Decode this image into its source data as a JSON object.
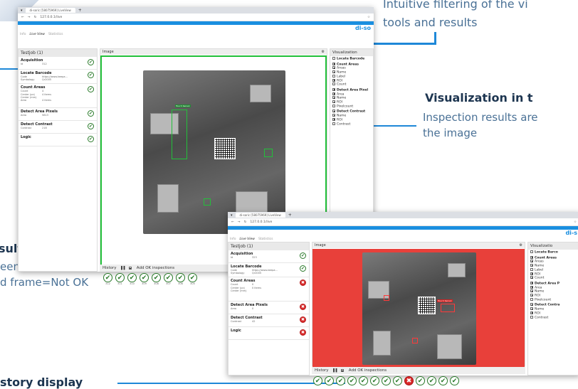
{
  "callouts": {
    "filter_line1": "Intuitive filtering of the vi",
    "filter_line2": "tools and results",
    "vis_title": "Visualization in t",
    "vis_line1": "Inspection results are",
    "vis_line2": "the image",
    "result_title": "sult display",
    "result_line1": "een frame=OK",
    "result_line2": "d frame=Not OK",
    "history_title": "story display"
  },
  "win1": {
    "tab": "di-soric [58075969] LiveView",
    "url": "127.0.0.1/live",
    "brand": "di-so",
    "menu": [
      "Info",
      "Live View",
      "Statistics"
    ],
    "left_title": "Testjob (1)",
    "steps": [
      {
        "name": "Acquisition",
        "rows": [
          [
            "Id",
            "312"
          ]
        ],
        "status": "ok"
      },
      {
        "name": "Locate Barcode",
        "rows": [
          [
            "Code",
            "https://www.keepa..."
          ],
          [
            "Symbology",
            "Qr2005"
          ]
        ],
        "status": "ok"
      },
      {
        "name": "Count Areas",
        "rows": [
          [
            "Count",
            "4"
          ],
          [
            "Center (px)",
            "4 items"
          ],
          [
            "Center (mm)",
            ""
          ],
          [
            "Area",
            "4 items"
          ]
        ],
        "status": "ok"
      },
      {
        "name": "Detect Area Pixels",
        "rows": [
          [
            "Area",
            "5813"
          ]
        ],
        "status": "ok"
      },
      {
        "name": "Detect Contrast",
        "rows": [
          [
            "Contrast",
            "218"
          ]
        ],
        "status": "ok"
      },
      {
        "name": "Logic",
        "rows": [],
        "status": "ok"
      }
    ],
    "image_title": "Image",
    "vis_title": "Visualization",
    "vis_groups": [
      {
        "title": "Locate Barcode",
        "items": [],
        "checked": false
      },
      {
        "title": "Count Areas",
        "items": [
          [
            "Areas",
            true
          ],
          [
            "Name",
            true
          ],
          [
            "Label",
            false
          ],
          [
            "ROI",
            true
          ],
          [
            "Count",
            false
          ]
        ],
        "checked": true
      },
      {
        "title": "Detect Area Pixel",
        "items": [
          [
            "Area",
            true
          ],
          [
            "Name",
            true
          ],
          [
            "ROI",
            true
          ],
          [
            "Pixelcount",
            false
          ]
        ],
        "checked": true
      },
      {
        "title": "Detect Contrast",
        "items": [
          [
            "Name",
            true
          ],
          [
            "ROI",
            true
          ],
          [
            "Contrast",
            false
          ]
        ],
        "checked": true
      }
    ],
    "history_label": "History",
    "add_ok": "Add OK inspections",
    "history_ids": [
      "312",
      "311",
      "310",
      "309",
      "308",
      "307",
      "306",
      "305"
    ],
    "board_tag": "Touch Sensor"
  },
  "win2": {
    "tab": "di-soric [58075969] LiveView",
    "url": "127.0.0.1/live",
    "brand": "di-s",
    "menu": [
      "Info",
      "Live View",
      "Statistics"
    ],
    "left_title": "Testjob (1)",
    "steps": [
      {
        "name": "Acquisition",
        "rows": [
          [
            "Id",
            "323"
          ]
        ],
        "status": "ok"
      },
      {
        "name": "Locate Barcode",
        "rows": [
          [
            "Code",
            "https://www.keepa..."
          ],
          [
            "Symbology",
            "Qr2005"
          ]
        ],
        "status": "ok"
      },
      {
        "name": "Count Areas",
        "rows": [
          [
            "Count",
            "0"
          ],
          [
            "Center (px)",
            "0 items"
          ],
          [
            "Center (mm)",
            ""
          ]
        ],
        "status": "bad"
      },
      {
        "name": "Detect Area Pixels",
        "rows": [
          [
            "Area",
            "0"
          ]
        ],
        "status": "bad"
      },
      {
        "name": "Detect Contrast",
        "rows": [
          [
            "Contrast",
            "42"
          ]
        ],
        "status": "bad"
      },
      {
        "name": "Logic",
        "rows": [],
        "status": "bad"
      }
    ],
    "image_title": "Image",
    "vis_title": "Visualizatio",
    "vis_groups": [
      {
        "title": "Locate Barco",
        "items": [],
        "checked": false
      },
      {
        "title": "Count Areas",
        "items": [
          [
            "Areas",
            true
          ],
          [
            "Name",
            true
          ],
          [
            "Label",
            false
          ],
          [
            "ROI",
            true
          ],
          [
            "Count",
            true
          ]
        ],
        "checked": true
      },
      {
        "title": "Detect Area P",
        "items": [
          [
            "Area",
            true
          ],
          [
            "Name",
            true
          ],
          [
            "ROI",
            true
          ],
          [
            "Pixelcount",
            false
          ]
        ],
        "checked": true
      },
      {
        "title": "Detect Contra",
        "items": [
          [
            "Name",
            true
          ],
          [
            "ROI",
            true
          ],
          [
            "Contrast",
            false
          ]
        ],
        "checked": true
      }
    ],
    "history_label": "History",
    "add_ok": "Add OK inspections",
    "history_status": [
      "ok",
      "ok",
      "ok",
      "ok",
      "ok",
      "ok",
      "ok",
      "ok",
      "bad",
      "ok",
      "ok",
      "ok",
      "ok"
    ],
    "board_tag": "Touch Sensor"
  },
  "colors": {
    "accent": "#1a8fe0",
    "ok_frame": "#22c03a",
    "nok_frame": "#e8403a"
  }
}
